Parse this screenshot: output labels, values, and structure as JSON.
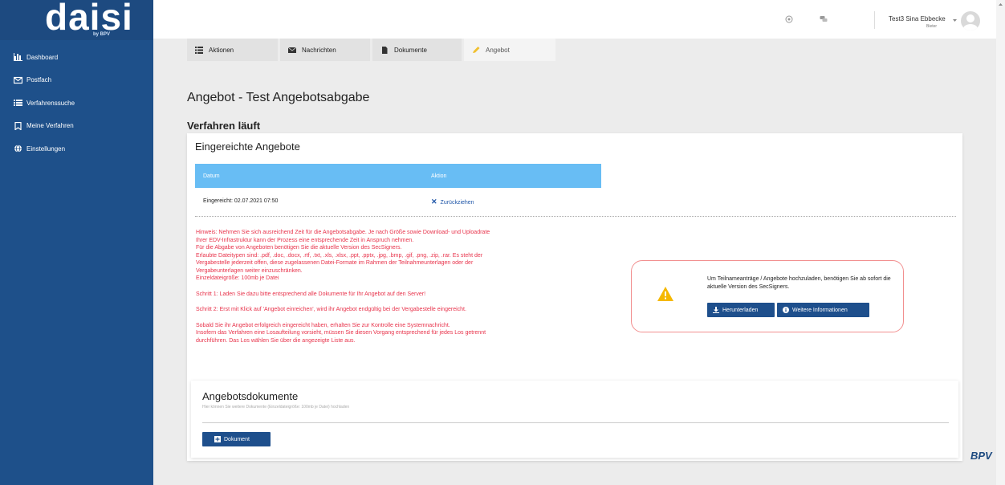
{
  "brand": {
    "logo": "daisi",
    "logo_sub": "by BPV",
    "footer_logo": "BPV"
  },
  "sidebar": {
    "items": [
      {
        "label": "Dashboard",
        "icon": "chart-icon"
      },
      {
        "label": "Postfach",
        "icon": "mail-icon"
      },
      {
        "label": "Verfahrenssuche",
        "icon": "list-icon"
      },
      {
        "label": "Meine Verfahren",
        "icon": "bookmark-icon"
      },
      {
        "label": "Einstellungen",
        "icon": "globe-icon"
      }
    ]
  },
  "header": {
    "user_name": "Test3 Sina Ebbecke",
    "user_role": "Bieter"
  },
  "tabs": [
    {
      "label": "Aktionen",
      "icon": "list-icon"
    },
    {
      "label": "Nachrichten",
      "icon": "envelope-icon"
    },
    {
      "label": "Dokumente",
      "icon": "document-icon"
    },
    {
      "label": "Angebot",
      "icon": "pencil-icon"
    }
  ],
  "page": {
    "title": "Angebot - Test Angebotsabgabe",
    "status": "Verfahren läuft"
  },
  "offers": {
    "title": "Eingereichte Angebote",
    "columns": [
      "Datum",
      "Aktion"
    ],
    "rows": [
      {
        "date": "Eingereicht: 02.07.2021 07:50",
        "action": "Zurückziehen"
      }
    ]
  },
  "hint": {
    "line1": "Hinweis: Nehmen Sie sich ausreichend Zeit für die Angebotsabgabe. Je nach Größe sowie Download- und Uploadrate",
    "line2": "Ihrer EDV-Infrastruktur kann der Prozess eine entsprechende Zeit in Anspruch nehmen.",
    "line3": "Für die Abgabe von Angeboten benötigen Sie die aktuelle Version des SecSigners.",
    "line4": "Erlaubte Dateitypen sind: .pdf, .doc, .docx, .rtf, .txt, .xls, .xlsx, .ppt, .pptx, .jpg, .bmp, .gif, .png, .zip, .rar. Es steht der",
    "line5": "Vergabestelle jederzeit offen, diese zugelassenen Datei-Formate im Rahmen der Teilnahmeunterlagen oder der",
    "line6": "Vergabeunterlagen weiter einzuschränken.",
    "line7": "Einzeldateigröße: 100mb je Datei",
    "step1": "Schritt 1: Laden Sie dazu bitte entsprechend alle Dokumente für Ihr Angebot auf den Server!",
    "step2": "Schritt 2: Erst mit Klick auf 'Angebot einreichen', wird ihr Angebot endgültig bei der Vergabestelle eingereicht.",
    "note1": "Sobald Sie ihr Angebot erfolgreich eingereicht haben, erhalten Sie zur Kontrolle eine Systemnachricht.",
    "note2": "Insofern das Verfahren eine Losaufteilung vorsieht, müssen Sie diesen Vorgang entsprechend für jedes Los getrennt",
    "note3": "durchführen. Das Los wählen Sie über die angezeigte Liste aus."
  },
  "alert": {
    "text": "Um Teilnameanträge / Angebote hochzuladen, benötigen Sie ab sofort die aktuelle Version des SecSigners.",
    "download_label": "Herunterladen",
    "info_label": "Weitere Informationen"
  },
  "documents": {
    "title": "Angebotsdokumente",
    "subtitle": "Hier können Sie weitere Dokumente (Einzeldateigröße: 100mb je Datei) hochladen",
    "add_label": "Dokument"
  },
  "colors": {
    "sidebar": "#1e508a",
    "table_header": "#68bdf4",
    "hint_text": "#e8334b",
    "button": "#1e4f8c"
  }
}
